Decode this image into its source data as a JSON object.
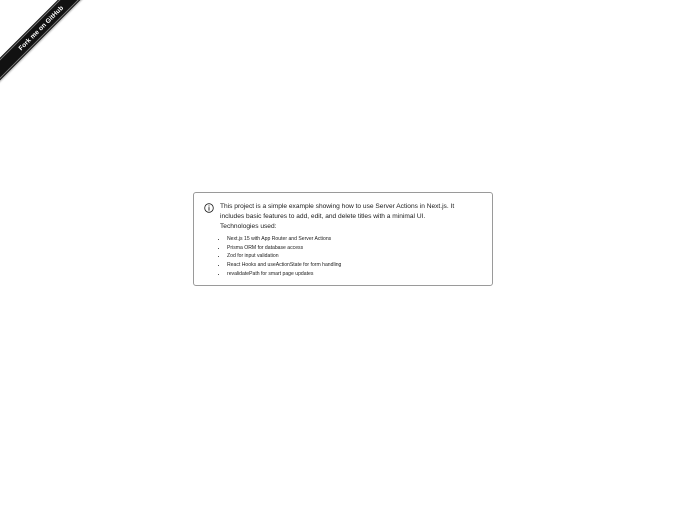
{
  "ribbon": {
    "label": "Fork me on GitHub"
  },
  "alert": {
    "icon": "info-circle-icon",
    "description": "This project is a simple example showing how to use Server Actions in Next.js. It includes basic features to add, edit, and delete titles with a minimal UI.",
    "technologies_label": "Technologies used:",
    "technologies": [
      "Next.js 15 with App Router and Server Actions",
      "Prisma ORM for database access",
      "Zod for input validation",
      "React Hooks and useActionState for form handling",
      "revalidatePath for smart page updates"
    ]
  },
  "colors": {
    "ribbon_bg": "#111111",
    "ribbon_text": "#ffffff",
    "alert_border": "#9a9a9a",
    "text": "#1a1a1a"
  }
}
